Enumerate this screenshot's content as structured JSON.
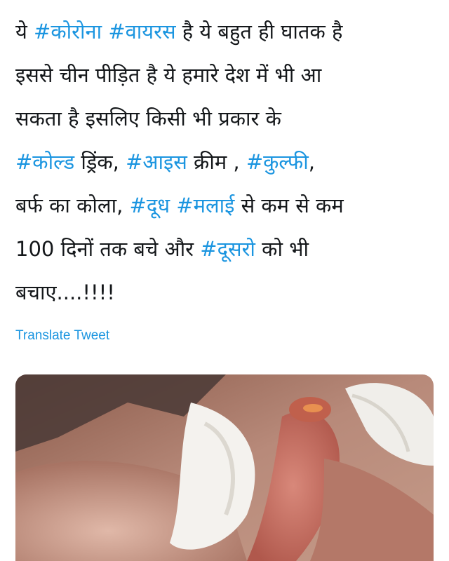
{
  "tweet": {
    "lines": [
      [
        {
          "t": "ये "
        },
        {
          "t": "#कोरोना",
          "tag": true
        },
        {
          "t": " "
        },
        {
          "t": "#वायरस",
          "tag": true
        },
        {
          "t": " है ये बहुत ही घातक है"
        }
      ],
      [
        {
          "t": "इससे चीन पीड़ित है ये हमारे देश में भी आ"
        }
      ],
      [
        {
          "t": "सकता है इसलिए किसी भी प्रकार के"
        }
      ],
      [
        {
          "t": "#कोल्ड",
          "tag": true
        },
        {
          "t": " ड्रिंक, "
        },
        {
          "t": "#आइस",
          "tag": true
        },
        {
          "t": " क्रीम , "
        },
        {
          "t": "#कुल्फी",
          "tag": true
        },
        {
          "t": ","
        }
      ],
      [
        {
          "t": "बर्फ का कोला, "
        },
        {
          "t": "#दूध",
          "tag": true
        },
        {
          "t": " "
        },
        {
          "t": "#मलाई",
          "tag": true
        },
        {
          "t": " से कम से कम"
        }
      ],
      [
        {
          "t": "100 दिनों तक बचे और "
        },
        {
          "t": "#दूसरो",
          "tag": true
        },
        {
          "t": " को भी"
        }
      ],
      [
        {
          "t": "बचाए....!!!!"
        }
      ]
    ],
    "translate_label": "Translate Tweet"
  },
  "colors": {
    "link": "#1b95e0",
    "text": "#14171a",
    "background": "#ffffff"
  },
  "media": {
    "description_icon": "photo-thumbnail"
  }
}
